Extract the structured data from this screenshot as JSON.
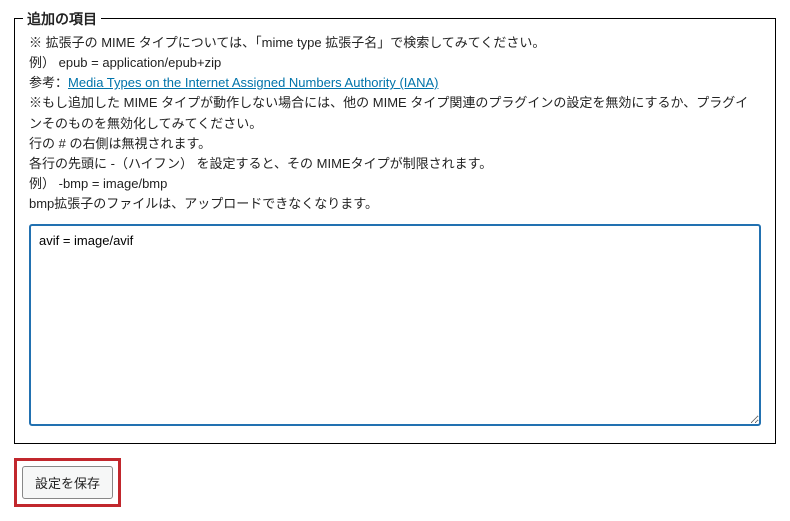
{
  "fieldset": {
    "legend": "追加の項目",
    "description": {
      "line1": "※ 拡張子の MIME タイプについては、「mime type 拡張子名」で検索してみてください。",
      "line2": "例） epub = application/epub+zip",
      "line3_prefix": "参考：",
      "line3_link": "Media Types on the Internet Assigned Numbers Authority (IANA)",
      "line4": "※もし追加した MIME タイプが動作しない場合には、他の MIME タイプ関連のプラグインの設定を無効にするか、プラグインそのものを無効化してみてください。",
      "line5": "行の # の右側は無視されます。",
      "line6": "各行の先頭に -（ハイフン） を設定すると、その MIMEタイプが制限されます。",
      "line7": "例） -bmp = image/bmp",
      "line8": "bmp拡張子のファイルは、アップロードできなくなります。"
    },
    "textarea_value": "avif = image/avif"
  },
  "buttons": {
    "save_label": "設定を保存"
  }
}
